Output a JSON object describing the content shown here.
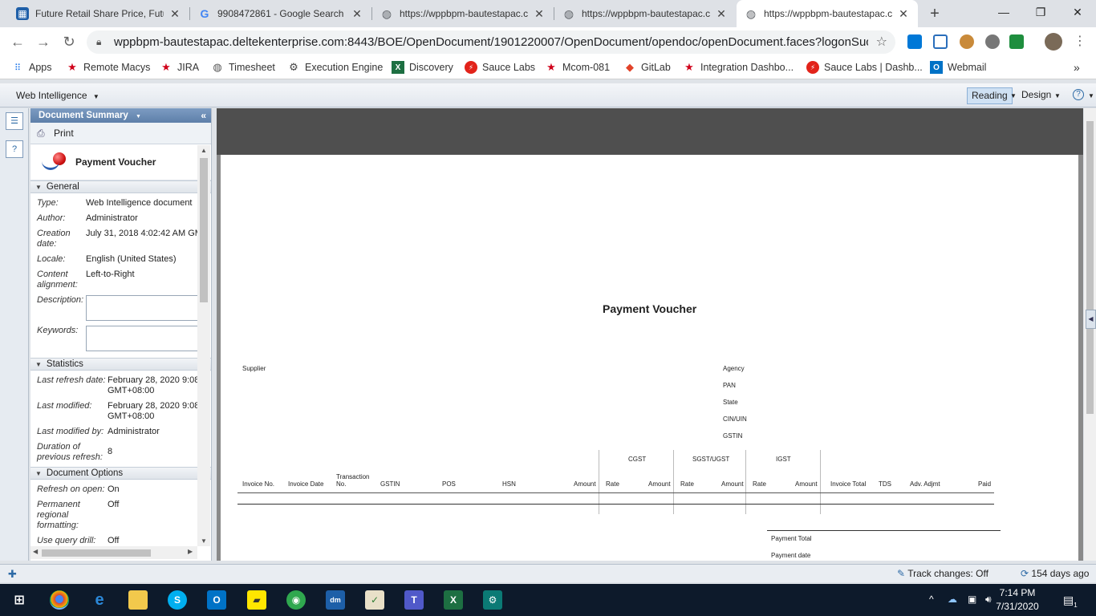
{
  "browser": {
    "tabs": [
      {
        "title": "Future Retail Share Price, Futur",
        "icon": "chart-favicon-icon",
        "color": "#1f5fa8"
      },
      {
        "title": "9908472861 - Google Search",
        "icon": "google-icon",
        "color": "#4285f4"
      },
      {
        "title": "https://wppbpm-bautestapac.c",
        "icon": "globe-icon",
        "color": "#5f6368"
      },
      {
        "title": "https://wppbpm-bautestapac.c",
        "icon": "globe-icon",
        "color": "#5f6368"
      },
      {
        "title": "https://wppbpm-bautestapac.c",
        "icon": "globe-icon",
        "color": "#5f6368"
      }
    ],
    "url": "wppbpm-bautestapac.deltekenterprise.com:8443/BOE/OpenDocument/1901220007/OpenDocument/opendoc/openDocument.faces?logonSuccessful...",
    "bookmarks": [
      {
        "label": "Apps",
        "icon": "apps-grid-icon"
      },
      {
        "label": "Remote Macys",
        "icon": "red-star-icon"
      },
      {
        "label": "JIRA",
        "icon": "red-star-icon"
      },
      {
        "label": "Timesheet",
        "icon": "globe-icon"
      },
      {
        "label": "Execution Engine",
        "icon": "gear-icon"
      },
      {
        "label": "Discovery",
        "icon": "excel-icon"
      },
      {
        "label": "Sauce Labs",
        "icon": "sauce-labs-icon"
      },
      {
        "label": "Mcom-081",
        "icon": "red-star-icon"
      },
      {
        "label": "GitLab",
        "icon": "gitlab-icon"
      },
      {
        "label": "Integration Dashbo...",
        "icon": "red-star-icon"
      },
      {
        "label": "Sauce Labs | Dashb...",
        "icon": "sauce-labs-icon"
      },
      {
        "label": "Webmail",
        "icon": "outlook-icon"
      }
    ],
    "more_bookmarks": "»"
  },
  "app": {
    "name": "Web Intelligence",
    "modes": {
      "reading": "Reading",
      "design": "Design"
    }
  },
  "panel": {
    "header": "Document Summary",
    "print": "Print",
    "doc_title": "Payment Voucher",
    "general": {
      "label": "General",
      "type_k": "Type:",
      "type_v": "Web Intelligence document",
      "author_k": "Author:",
      "author_v": "Administrator",
      "created_k": "Creation date:",
      "created_v": "July 31, 2018 4:02:42 AM GM",
      "locale_k": "Locale:",
      "locale_v": "English (United States)",
      "align_k": "Content alignment:",
      "align_v": "Left-to-Right",
      "desc_k": "Description:",
      "keywords_k": "Keywords:"
    },
    "statistics": {
      "label": "Statistics",
      "refresh_k": "Last refresh date:",
      "refresh_v1": "February 28, 2020 9:08",
      "refresh_v2": "GMT+08:00",
      "modified_k": "Last modified:",
      "modified_v1": "February 28, 2020 9:08",
      "modified_v2": "GMT+08:00",
      "modified_by_k": "Last modified by:",
      "modified_by_v": "Administrator",
      "duration_k": "Duration of previous refresh:",
      "duration_v": "8"
    },
    "options": {
      "label": "Document Options",
      "refresh_open_k": "Refresh on open:",
      "refresh_open_v": "On",
      "regional_k": "Permanent regional formatting:",
      "regional_v": "Off",
      "drill_k": "Use query drill:",
      "drill_v": "Off"
    }
  },
  "report": {
    "title": "Payment Voucher",
    "supplier": "Supplier",
    "right_labels": [
      "Agency",
      "PAN",
      "State",
      "CIN/UIN",
      "GSTIN"
    ],
    "group_headers": {
      "cgst": "CGST",
      "sgst": "SGST/UGST",
      "igst": "IGST"
    },
    "columns": {
      "invoice_no": "Invoice No.",
      "invoice_date": "Invoice Date",
      "transaction_1": "Transaction",
      "transaction_2": "No.",
      "gstin": "GSTIN",
      "pos": "POS",
      "hsn": "HSN",
      "amount": "Amount",
      "cgst_rate": "Rate",
      "cgst_amount": "Amount",
      "sgst_rate": "Rate",
      "sgst_amount": "Amount",
      "igst_rate": "Rate",
      "igst_amount": "Amount",
      "invoice_total": "Invoice Total",
      "tds": "TDS",
      "adv_adjmt": "Adv. Adjmt",
      "paid": "Paid"
    },
    "payment_total": "Payment Total",
    "payment_date": "Payment date"
  },
  "status": {
    "track_changes": "Track changes: Off",
    "age": "154 days ago"
  },
  "taskbar": {
    "time": "7:14 PM",
    "date": "7/31/2020",
    "notification_count": "1"
  }
}
